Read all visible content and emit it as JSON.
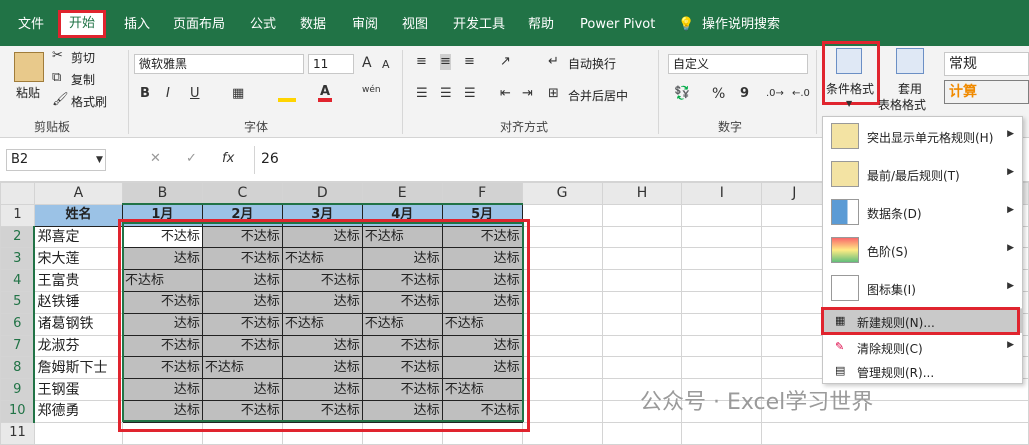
{
  "menubar": {
    "tabs": [
      "文件",
      "开始",
      "插入",
      "页面布局",
      "公式",
      "数据",
      "审阅",
      "视图",
      "开发工具",
      "帮助",
      "Power Pivot",
      "操作说明搜索"
    ]
  },
  "ribbon": {
    "clipboard": {
      "paste": "粘贴",
      "cut": "剪切",
      "copy": "复制",
      "format_painter": "格式刷",
      "group": "剪贴板"
    },
    "font": {
      "name": "微软雅黑",
      "size": "11",
      "bold": "B",
      "italic": "I",
      "underline": "U",
      "group": "字体",
      "grow": "A",
      "shrink": "A",
      "phonetic": "wén"
    },
    "alignment": {
      "wrap": "自动换行",
      "merge": "合并后居中",
      "group": "对齐方式"
    },
    "number": {
      "format": "自定义",
      "percent": "%",
      "comma": "9",
      "group": "数字"
    },
    "styles": {
      "conditional": "条件格式",
      "table_line1": "套用",
      "table_line2": "表格格式",
      "style_normal": "常规",
      "style_calc": "计算"
    }
  },
  "formula_bar": {
    "cell_ref": "B2",
    "value": "26",
    "fx": "fx"
  },
  "columns": [
    "A",
    "B",
    "C",
    "D",
    "E",
    "F",
    "G",
    "H",
    "I",
    "J"
  ],
  "rows": [
    "1",
    "2",
    "3",
    "4",
    "5",
    "6",
    "7",
    "8",
    "9",
    "10",
    "11"
  ],
  "headers": [
    "姓名",
    "1月",
    "2月",
    "3月",
    "4月",
    "5月"
  ],
  "names": [
    "郑喜定",
    "宋大莲",
    "王富贵",
    "赵铁锤",
    "诸葛钢铁",
    "龙淑芬",
    "詹姆斯下士",
    "王钢蛋",
    "郑德勇"
  ],
  "values": [
    [
      "不达标",
      "不达标",
      "达标",
      "不达标",
      "不达标"
    ],
    [
      "达标",
      "不达标",
      "不达标",
      "达标",
      "达标"
    ],
    [
      "不达标",
      "达标",
      "不达标",
      "不达标",
      "达标"
    ],
    [
      "不达标",
      "达标",
      "达标",
      "不达标",
      "达标"
    ],
    [
      "达标",
      "不达标",
      "不达标",
      "不达标",
      "不达标"
    ],
    [
      "不达标",
      "不达标",
      "达标",
      "不达标",
      "达标"
    ],
    [
      "不达标",
      "不达标",
      "达标",
      "不达标",
      "达标"
    ],
    [
      "达标",
      "达标",
      "达标",
      "不达标",
      "不达标"
    ],
    [
      "达标",
      "不达标",
      "不达标",
      "达标",
      "不达标"
    ]
  ],
  "menu": {
    "items": [
      {
        "label": "突出显示单元格规则(H)",
        "arrow": "▶"
      },
      {
        "label": "最前/最后规则(T)",
        "arrow": "▶"
      },
      {
        "label": "数据条(D)",
        "arrow": "▶"
      },
      {
        "label": "色阶(S)",
        "arrow": "▶"
      },
      {
        "label": "图标集(I)",
        "arrow": "▶"
      },
      {
        "label": "新建规则(N)..."
      },
      {
        "label": "清除规则(C)",
        "arrow": "▶"
      },
      {
        "label": "管理规则(R)..."
      }
    ]
  },
  "watermark": "公众号 · Excel学习世界",
  "colors": {
    "excel_green": "#217346",
    "highlight_red": "#e0242e",
    "header_blue": "#9bc2e6",
    "cell_gray": "#bfbfbf"
  }
}
